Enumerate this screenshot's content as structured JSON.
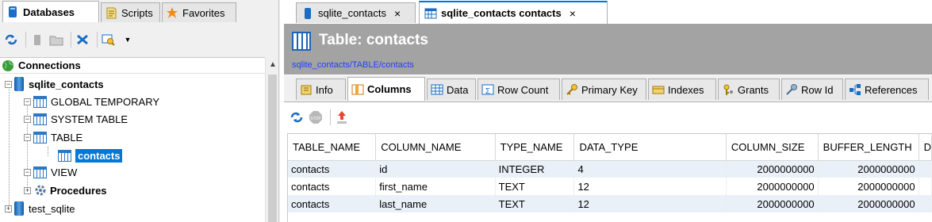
{
  "left": {
    "tabs": [
      {
        "label": "Databases",
        "icon": "database-icon"
      },
      {
        "label": "Scripts",
        "icon": "script-icon"
      },
      {
        "label": "Favorites",
        "icon": "star-icon"
      }
    ],
    "tree_header": "Connections",
    "tree": {
      "connection": "sqlite_contacts",
      "items": [
        "GLOBAL TEMPORARY",
        "SYSTEM TABLE",
        "TABLE"
      ],
      "selected": "contacts",
      "view": "VIEW",
      "procedures": "Procedures",
      "second_connection": "test_sqlite"
    }
  },
  "right": {
    "doc_tabs": [
      {
        "label": "sqlite_contacts",
        "close": "×"
      },
      {
        "label": "sqlite_contacts contacts",
        "close": "×"
      }
    ],
    "header_title": "Table: contacts",
    "header_path": "sqlite_contacts/TABLE/contacts",
    "subtabs": [
      "Info",
      "Columns",
      "Data",
      "Row Count",
      "Primary Key",
      "Indexes",
      "Grants",
      "Row Id",
      "References"
    ],
    "active_subtab": "Columns",
    "columns": [
      "TABLE_NAME",
      "COLUMN_NAME",
      "TYPE_NAME",
      "DATA_TYPE",
      "COLUMN_SIZE",
      "BUFFER_LENGTH",
      "D"
    ],
    "rows": [
      [
        "contacts",
        "id",
        "INTEGER",
        "4",
        "2000000000",
        "2000000000"
      ],
      [
        "contacts",
        "first_name",
        "TEXT",
        "12",
        "2000000000",
        "2000000000"
      ],
      [
        "contacts",
        "last_name",
        "TEXT",
        "12",
        "2000000000",
        "2000000000"
      ]
    ]
  },
  "colors": {
    "selection": "#0078d7",
    "header_bg": "#a3a3a3",
    "path_link": "#1d40ff",
    "row_stripe": "#eaf0f8"
  }
}
